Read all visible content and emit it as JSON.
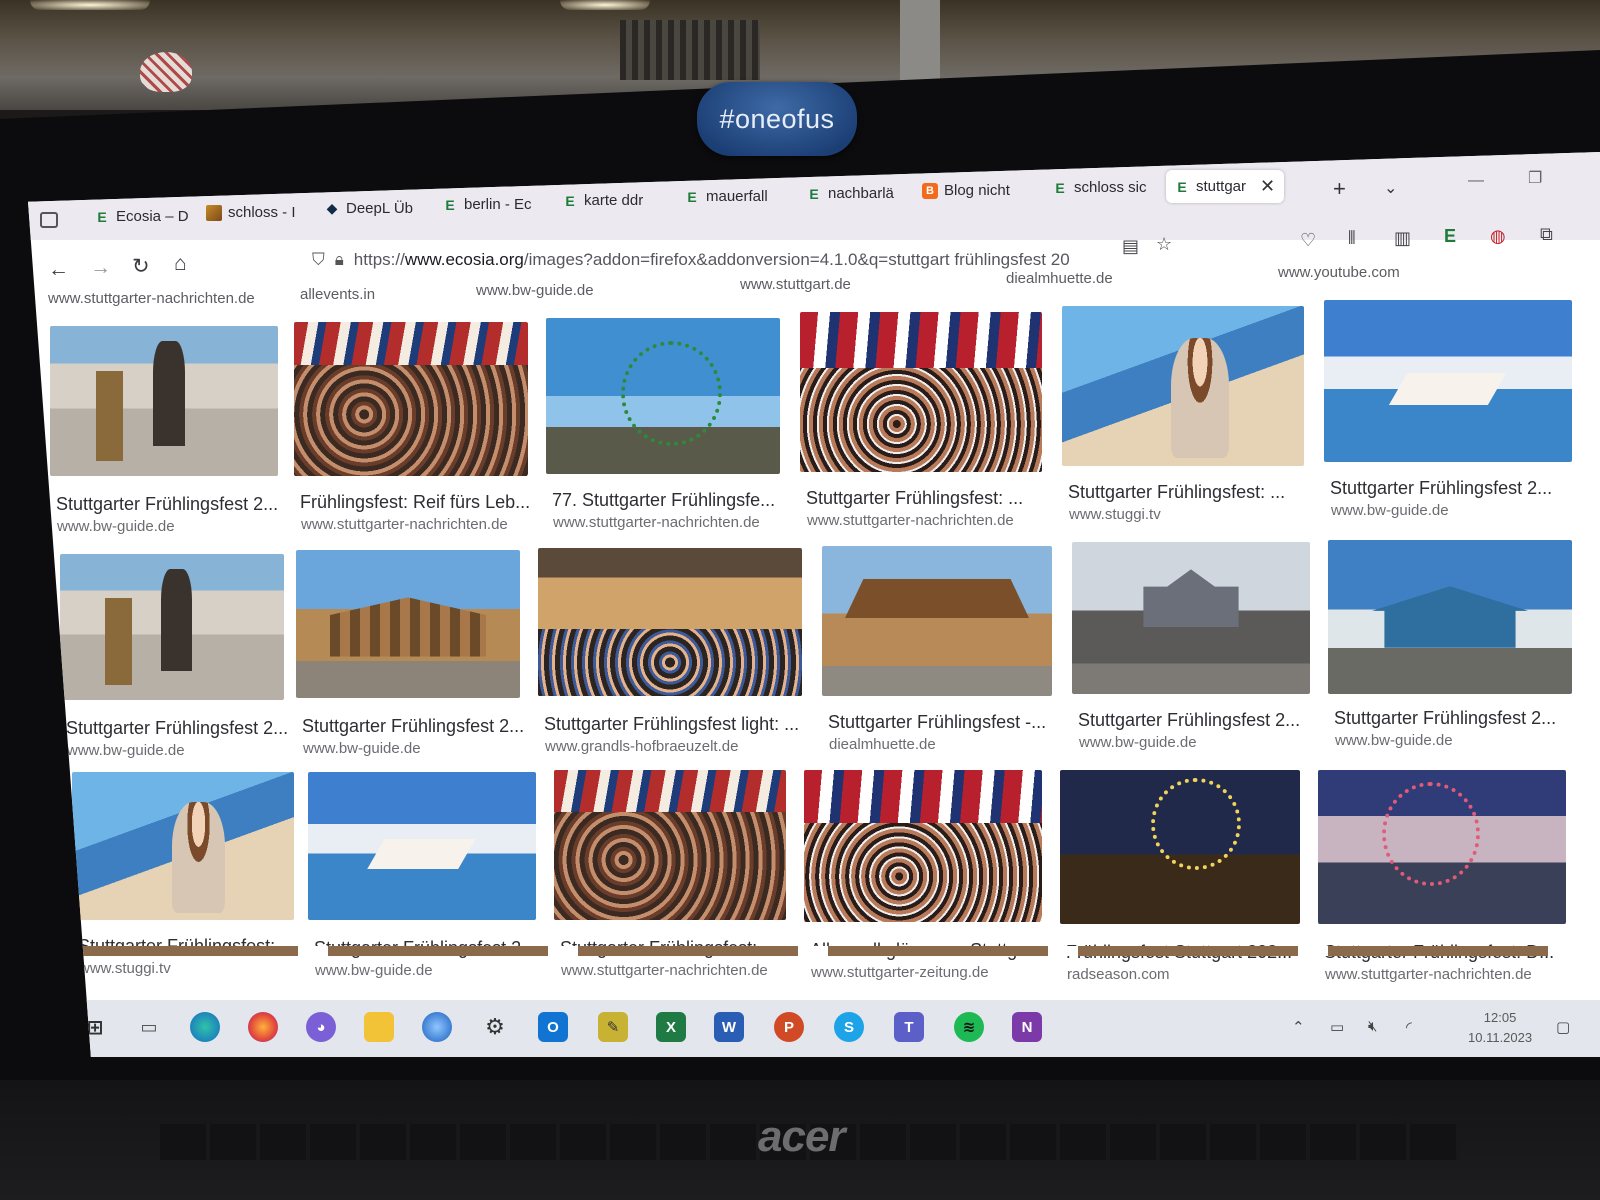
{
  "sticker_text": "#oneofus",
  "laptop_brand": "acer",
  "browser": {
    "tabs": [
      {
        "label": "Ecosia – D",
        "icon": "ecosia-icon"
      },
      {
        "label": "schloss - I",
        "icon": "image-icon"
      },
      {
        "label": "DeepL Üb",
        "icon": "deepl-icon"
      },
      {
        "label": "berlin - Ec",
        "icon": "ecosia-icon"
      },
      {
        "label": "karte ddr",
        "icon": "ecosia-icon"
      },
      {
        "label": "mauerfall",
        "icon": "ecosia-icon"
      },
      {
        "label": "nachbarlä",
        "icon": "ecosia-icon"
      },
      {
        "label": "Blog nicht",
        "icon": "blogger-icon"
      },
      {
        "label": "schloss sic",
        "icon": "ecosia-icon"
      },
      {
        "label": "stuttgar",
        "icon": "ecosia-icon",
        "active": true
      }
    ],
    "url_prefix": "https://",
    "url_host": "www.ecosia.org",
    "url_rest": "/images?addon=firefox&addonversion=4.1.0&q=stuttgart frühlingsfest 20"
  },
  "previous_row_sources": [
    "www.stuttgarter-nachrichten.de",
    "allevents.in",
    "www.bw-guide.de",
    "www.stuttgart.de",
    "diealmhuette.de",
    "www.youtube.com"
  ],
  "results": [
    {
      "title": "Stuttgarter Frühlingsfest 2...",
      "source": "www.bw-guide.de"
    },
    {
      "title": "Frühlingsfest: Reif fürs Leb...",
      "source": "www.stuttgarter-nachrichten.de"
    },
    {
      "title": "77. Stuttgarter Frühlingsfe...",
      "source": "www.stuttgarter-nachrichten.de"
    },
    {
      "title": "Stuttgarter Frühlingsfest: ...",
      "source": "www.stuttgarter-nachrichten.de"
    },
    {
      "title": "Stuttgarter Frühlingsfest: ...",
      "source": "www.stuggi.tv"
    },
    {
      "title": "Stuttgarter Frühlingsfest 2...",
      "source": "www.bw-guide.de"
    },
    {
      "title": "Stuttgarter Frühlingsfest 2...",
      "source": "www.bw-guide.de"
    },
    {
      "title": "Stuttgarter Frühlingsfest 2...",
      "source": "www.bw-guide.de"
    },
    {
      "title": "Stuttgarter Frühlingsfest light: ...",
      "source": "www.grandls-hofbraeuzelt.de"
    },
    {
      "title": "Stuttgarter Frühlingsfest -...",
      "source": "diealmhuette.de"
    },
    {
      "title": "Stuttgarter Frühlingsfest 2...",
      "source": "www.bw-guide.de"
    },
    {
      "title": "Stuttgarter Frühlingsfest 2...",
      "source": "www.bw-guide.de"
    },
    {
      "title": "Stuttgarter Frühlingsfest: ...",
      "source": "www.stuggi.tv"
    },
    {
      "title": "Stuttgarter Frühlingsfest 2...",
      "source": "www.bw-guide.de"
    },
    {
      "title": "Stuttgarter Frühlingsfest: ...",
      "source": "www.stuttgarter-nachrichten.de"
    },
    {
      "title": "Alles soll glänzen. - Stuttga...",
      "source": "www.stuttgarter-zeitung.de"
    },
    {
      "title": "Frühlingsfest Stuttgart 202...",
      "source": "radseason.com"
    },
    {
      "title": "Stuttgarter Frühlingsfest: D...",
      "source": "www.stuttgarter-nachrichten.de"
    }
  ],
  "taskbar": {
    "apps": [
      "windows-start-icon",
      "task-view-icon",
      "edge-icon",
      "firefox-icon",
      "teams-chat-icon",
      "file-explorer-icon",
      "thunderbird-icon",
      "settings-gear-icon",
      "outlook-icon",
      "notepad-icon",
      "excel-icon",
      "word-icon",
      "powerpoint-icon",
      "skype-icon",
      "teams-icon",
      "spotify-icon",
      "onenote-icon"
    ],
    "time": "12:05",
    "date": "10.11.2023"
  }
}
